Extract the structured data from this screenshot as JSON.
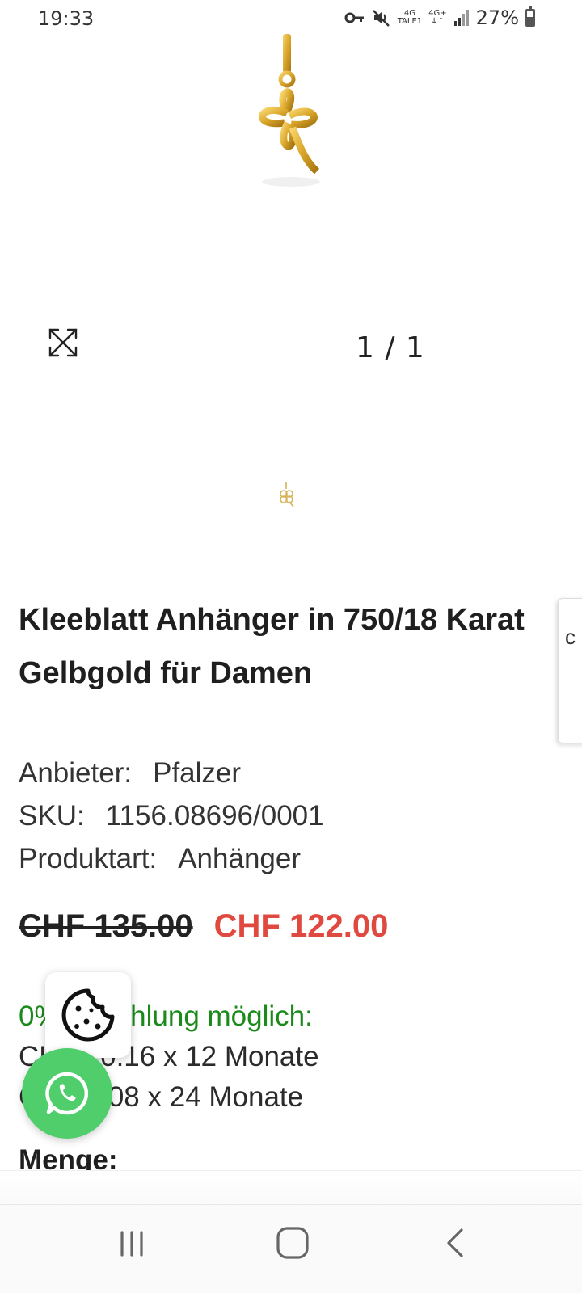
{
  "status_bar": {
    "time": "19:33",
    "network_1_top": "4G",
    "network_1_bottom": "TALE1",
    "network_2": "4G+",
    "battery": "27%"
  },
  "gallery": {
    "counter": "1 / 1"
  },
  "product": {
    "title": "Kleeblatt Anhänger in 750/18 Karat Gelbgold für Damen",
    "vendor_label": "Anbieter:",
    "vendor_value": "Pfalzer",
    "sku_label": "SKU:",
    "sku_value": "1156.08696/0001",
    "type_label": "Produktart:",
    "type_value": "Anhänger",
    "price_old": "CHF 135.00",
    "price_new": "CHF 122.00",
    "financing_headline": "0% Anzahlung möglich:",
    "financing_line1": "CHF 10.16 x 12 Monate",
    "financing_line2": "CHF 5.08 x 24 Monate",
    "quantity_label": "Menge:"
  },
  "colors": {
    "sale_price": "#e0493f",
    "financing_green": "#1a8a1a",
    "whatsapp_green": "#4fce6b"
  },
  "icons": [
    "key-icon",
    "mute-icon",
    "signal-icon",
    "battery-icon",
    "expand-icon",
    "cookie-icon",
    "whatsapp-icon",
    "nav-recent-icon",
    "nav-home-icon",
    "nav-back-icon"
  ]
}
